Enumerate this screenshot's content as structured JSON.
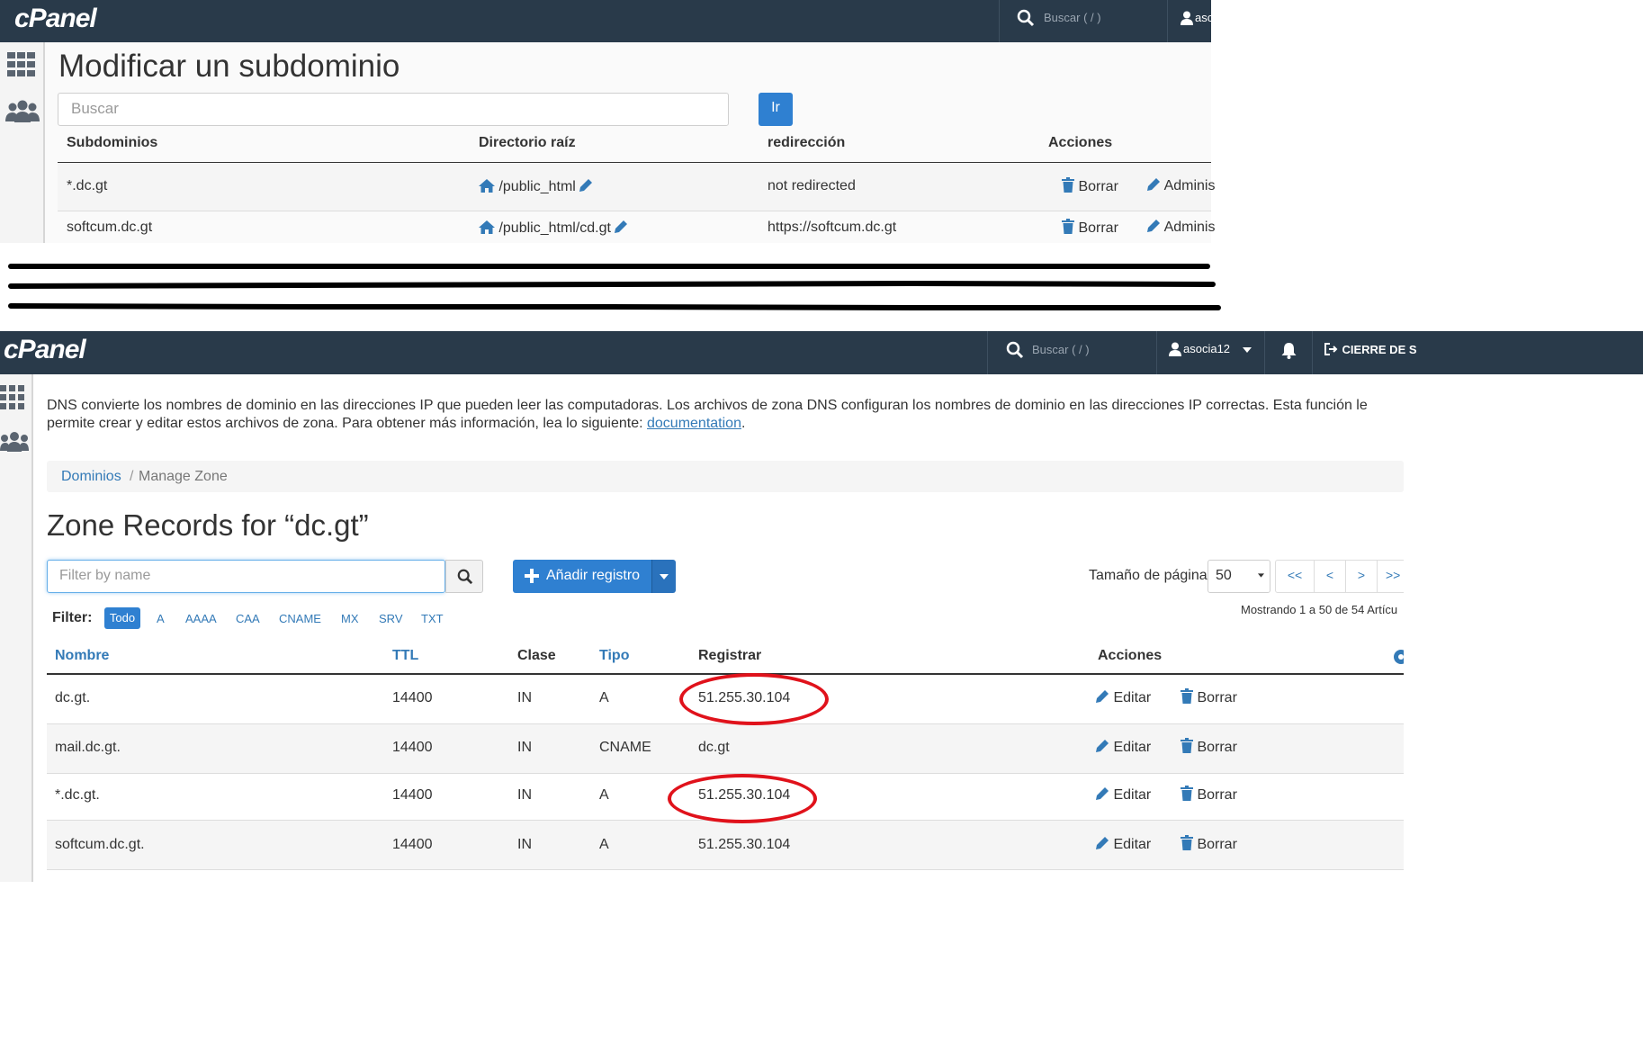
{
  "top_panel": {
    "brand": "cPanel",
    "search_placeholder": "Buscar ( / )",
    "user_truncated": "asc",
    "page_title": "Modificar un subdominio",
    "search_input_placeholder": "Buscar",
    "go_button": "Ir",
    "columns": [
      "Subdominios",
      "Directorio raíz",
      "redirección",
      "Acciones"
    ],
    "rows": [
      {
        "subdomain": "*.dc.gt",
        "docroot": "/public_html",
        "redirect": "not redirected",
        "delete": "Borrar",
        "manage": "Adminis"
      },
      {
        "subdomain": "softcum.dc.gt",
        "docroot": "/public_html/cd.gt",
        "redirect": "https://softcum.dc.gt",
        "delete": "Borrar",
        "manage": "Adminis"
      }
    ]
  },
  "bottom_panel": {
    "brand": "cPanel",
    "search_placeholder": "Buscar ( / )",
    "username": "asocia12",
    "logout_truncated": "CIERRE DE S",
    "intro_text": "DNS convierte los nombres de dominio en las direcciones IP que pueden leer las computadoras. Los archivos de zona DNS configuran los nombres de dominio en las direcciones IP correctas. Esta función le permite crear y editar estos archivos de zona. Para obtener más información, lea lo siguiente: ",
    "intro_link": "documentation",
    "intro_end": ".",
    "breadcrumb": {
      "home": "Dominios",
      "separator": "/",
      "current": "Manage Zone"
    },
    "title": "Zone Records for “dc.gt”",
    "filter_placeholder": "Filter by name",
    "add_button": "Añadir registro",
    "page_size_label": "Tamaño de página",
    "page_size_value": "50",
    "pager": [
      "<<",
      "<",
      ">",
      ">>"
    ],
    "filter_label": "Filter:",
    "filters": [
      "Todo",
      "A",
      "AAAA",
      "CAA",
      "CNAME",
      "MX",
      "SRV",
      "TXT"
    ],
    "active_filter": "Todo",
    "showing_text": "Mostrando 1 a 50 de 54 Artícu",
    "columns": [
      "Nombre",
      "TTL",
      "Clase",
      "Tipo",
      "Registrar",
      "Acciones"
    ],
    "rows": [
      {
        "name": "dc.gt.",
        "ttl": "14400",
        "class": "IN",
        "type": "A",
        "record": "51.255.30.104",
        "edit": "Editar",
        "delete": "Borrar",
        "highlighted": true
      },
      {
        "name": "mail.dc.gt.",
        "ttl": "14400",
        "class": "IN",
        "type": "CNAME",
        "record": "dc.gt",
        "edit": "Editar",
        "delete": "Borrar",
        "highlighted": false
      },
      {
        "name": "*.dc.gt.",
        "ttl": "14400",
        "class": "IN",
        "type": "A",
        "record": "51.255.30.104",
        "edit": "Editar",
        "delete": "Borrar",
        "highlighted": true
      },
      {
        "name": "softcum.dc.gt.",
        "ttl": "14400",
        "class": "IN",
        "type": "A",
        "record": "51.255.30.104",
        "edit": "Editar",
        "delete": "Borrar",
        "highlighted": false
      }
    ]
  },
  "colors": {
    "topbar": "#293a4a",
    "link": "#337ab7",
    "button": "#2f80d1",
    "annotation": "#e0121b"
  }
}
